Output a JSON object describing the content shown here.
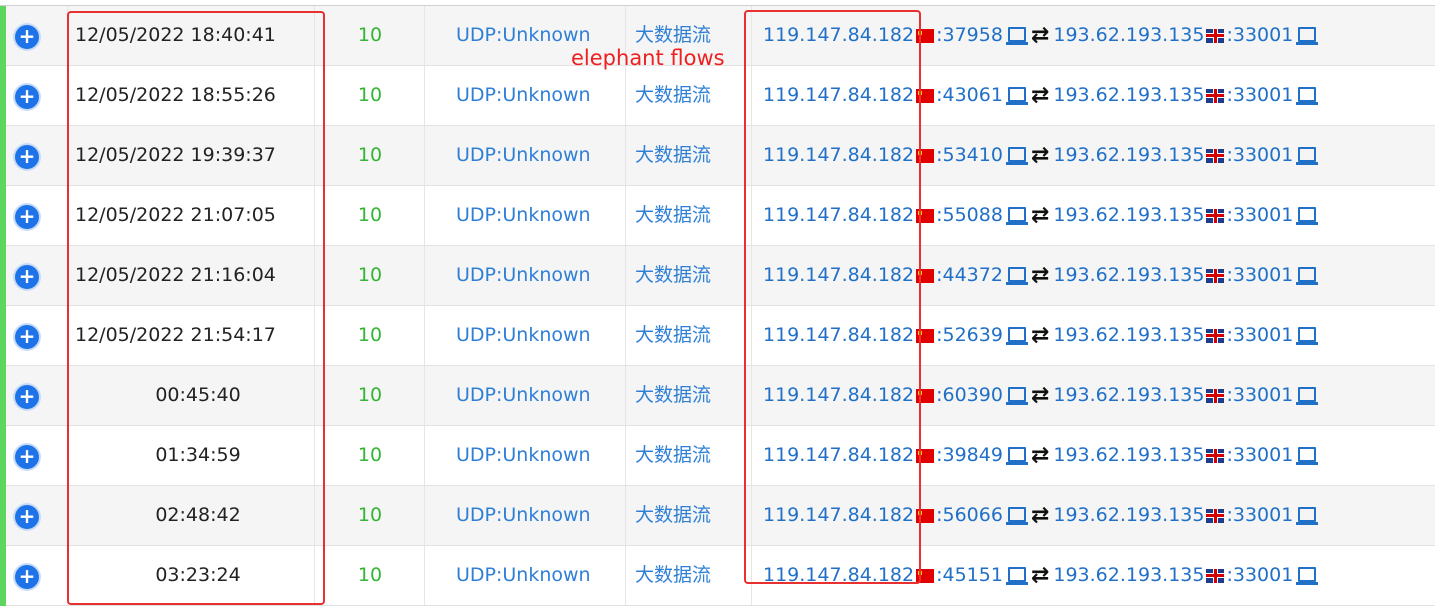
{
  "annotation": "elephant flows",
  "rows": [
    {
      "time": "12/05/2022 18:40:41",
      "score": "10",
      "protocol": "UDP:Unknown",
      "category": "大数据流",
      "src_ip": "119.147.84.182",
      "src_port": ":37958",
      "dst_ip": "193.62.193.135",
      "dst_port": ":33001"
    },
    {
      "time": "12/05/2022 18:55:26",
      "score": "10",
      "protocol": "UDP:Unknown",
      "category": "大数据流",
      "src_ip": "119.147.84.182",
      "src_port": ":43061",
      "dst_ip": "193.62.193.135",
      "dst_port": ":33001"
    },
    {
      "time": "12/05/2022 19:39:37",
      "score": "10",
      "protocol": "UDP:Unknown",
      "category": "大数据流",
      "src_ip": "119.147.84.182",
      "src_port": ":53410",
      "dst_ip": "193.62.193.135",
      "dst_port": ":33001"
    },
    {
      "time": "12/05/2022 21:07:05",
      "score": "10",
      "protocol": "UDP:Unknown",
      "category": "大数据流",
      "src_ip": "119.147.84.182",
      "src_port": ":55088",
      "dst_ip": "193.62.193.135",
      "dst_port": ":33001"
    },
    {
      "time": "12/05/2022 21:16:04",
      "score": "10",
      "protocol": "UDP:Unknown",
      "category": "大数据流",
      "src_ip": "119.147.84.182",
      "src_port": ":44372",
      "dst_ip": "193.62.193.135",
      "dst_port": ":33001"
    },
    {
      "time": "12/05/2022 21:54:17",
      "score": "10",
      "protocol": "UDP:Unknown",
      "category": "大数据流",
      "src_ip": "119.147.84.182",
      "src_port": ":52639",
      "dst_ip": "193.62.193.135",
      "dst_port": ":33001"
    },
    {
      "time": "00:45:40",
      "score": "10",
      "protocol": "UDP:Unknown",
      "category": "大数据流",
      "src_ip": "119.147.84.182",
      "src_port": ":60390",
      "dst_ip": "193.62.193.135",
      "dst_port": ":33001"
    },
    {
      "time": "01:34:59",
      "score": "10",
      "protocol": "UDP:Unknown",
      "category": "大数据流",
      "src_ip": "119.147.84.182",
      "src_port": ":39849",
      "dst_ip": "193.62.193.135",
      "dst_port": ":33001"
    },
    {
      "time": "02:48:42",
      "score": "10",
      "protocol": "UDP:Unknown",
      "category": "大数据流",
      "src_ip": "119.147.84.182",
      "src_port": ":56066",
      "dst_ip": "193.62.193.135",
      "dst_port": ":33001"
    },
    {
      "time": "03:23:24",
      "score": "10",
      "protocol": "UDP:Unknown",
      "category": "大数据流",
      "src_ip": "119.147.84.182",
      "src_port": ":45151",
      "dst_ip": "193.62.193.135",
      "dst_port": ":33001"
    }
  ],
  "icons": {
    "expand": "plus-circle-icon",
    "src_flag": "china-flag-icon",
    "dst_flag": "uk-flag-icon",
    "host": "laptop-icon",
    "direction": "bidirectional-arrows-icon"
  },
  "colors": {
    "accent_bar": "#5cd65c",
    "score": "#35b535",
    "link": "#2170c7",
    "highlight": "#e83030",
    "expand_button": "#1e73e8"
  }
}
